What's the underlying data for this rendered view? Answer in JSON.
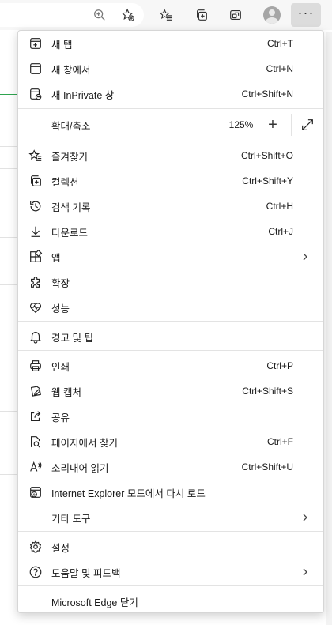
{
  "toolbar": {
    "icons": [
      "zoom-icon",
      "add-favorite-icon",
      "favorites-icon",
      "collections-icon",
      "share-icon",
      "profile-avatar",
      "more-icon"
    ],
    "more_label": "···"
  },
  "menu": {
    "new_tab": {
      "label": "새 탭",
      "shortcut": "Ctrl+T"
    },
    "new_window": {
      "label": "새 창에서",
      "shortcut": "Ctrl+N"
    },
    "new_inprivate": {
      "label": "새 InPrivate 창",
      "shortcut": "Ctrl+Shift+N"
    },
    "zoom": {
      "label": "확대/축소",
      "minus": "—",
      "value": "125%",
      "plus": "+"
    },
    "favorites": {
      "label": "즐겨찾기",
      "shortcut": "Ctrl+Shift+O"
    },
    "collections": {
      "label": "컬렉션",
      "shortcut": "Ctrl+Shift+Y"
    },
    "history": {
      "label": "검색 기록",
      "shortcut": "Ctrl+H"
    },
    "downloads": {
      "label": "다운로드",
      "shortcut": "Ctrl+J"
    },
    "apps": {
      "label": "앱"
    },
    "extensions": {
      "label": "확장"
    },
    "performance": {
      "label": "성능"
    },
    "alerts": {
      "label": "경고 및 팁"
    },
    "print": {
      "label": "인쇄",
      "shortcut": "Ctrl+P"
    },
    "web_capture": {
      "label": "웹 캡처",
      "shortcut": "Ctrl+Shift+S"
    },
    "share": {
      "label": "공유"
    },
    "find": {
      "label": "페이지에서 찾기",
      "shortcut": "Ctrl+F"
    },
    "read_aloud": {
      "label": "소리내어 읽기",
      "shortcut": "Ctrl+Shift+U"
    },
    "ie_mode": {
      "label": "Internet Explorer 모드에서 다시 로드"
    },
    "more_tools": {
      "label": "기타 도구"
    },
    "settings": {
      "label": "설정"
    },
    "help": {
      "label": "도움말 및 피드백"
    },
    "close_edge": {
      "label": "Microsoft Edge 닫기"
    }
  }
}
